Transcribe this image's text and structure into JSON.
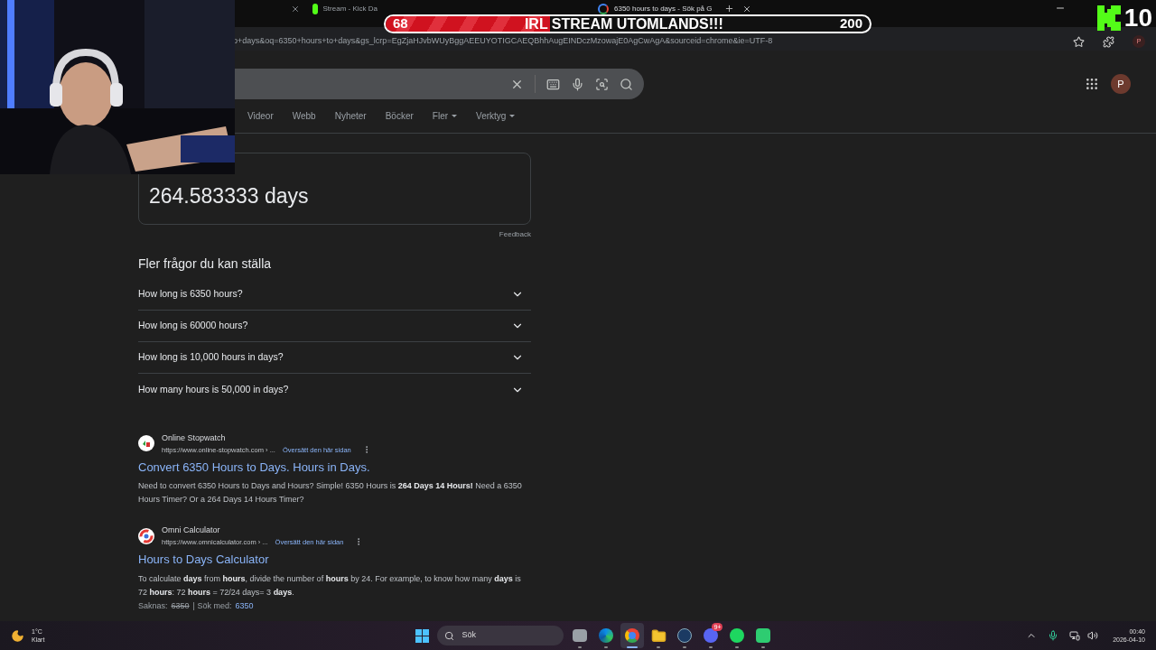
{
  "browser": {
    "tabs": [
      {
        "selected": false,
        "kind": "hidden"
      },
      {
        "title": "Stream - Kick Da",
        "selected": false,
        "kind": "kick"
      },
      {
        "title": "6350 hours to days - Sök på G",
        "selected": true,
        "kind": "google"
      }
    ],
    "url": "o+days&oq=6350+hours+to+days&gs_lcrp=EgZjaHJvbWUyBggAEEUYOTIGCAEQBhhAugEINDczMzowajE0AgCwAgA&sourceid=chrome&ie=UTF-8",
    "profile": "P"
  },
  "search": {
    "avatar": "P",
    "filters": [
      {
        "label": "Videor",
        "menu": false
      },
      {
        "label": "Webb",
        "menu": false
      },
      {
        "label": "Nyheter",
        "menu": false
      },
      {
        "label": "Böcker",
        "menu": false
      },
      {
        "label": "Fler",
        "menu": true
      },
      {
        "label": "Verktyg",
        "menu": true
      }
    ]
  },
  "calculator": {
    "result": "264.583333 days",
    "feedback": "Feedback"
  },
  "questions": {
    "heading": "Fler frågor du kan ställa",
    "items": [
      {
        "text": "How long is 6350 hours?",
        "expanded": false
      },
      {
        "text": "How long is 60000 hours?",
        "expanded": false
      },
      {
        "text": "How long is 10,000 hours in days?",
        "expanded": false
      },
      {
        "text": "How many hours is 50,000 in days?",
        "expanded": false
      }
    ]
  },
  "results": [
    {
      "kind": "stopwatch",
      "site": "Online Stopwatch",
      "url": "https://www.online-stopwatch.com › ...",
      "translate": "Översätt den här sidan",
      "title": "Convert 6350 Hours to Days. Hours in Days.",
      "snippet": "Need to convert 6350 Hours to Days and Hours? Simple! 6350 Hours is **264 Days 14 Hours!** Need a 6350 Hours Timer? Or a 264 Days 14 Hours Timer?"
    },
    {
      "kind": "omni",
      "site": "Omni Calculator",
      "url": "https://www.omnicalculator.com › ...",
      "translate": "Översätt den här sidan",
      "title": "Hours to Days Calculator",
      "snippet": "To calculate **days** from **hours**, divide the number of **hours** by 24. For example, to know how many **days** is 72 **hours**: 72 **hours** = 72/24 days= 3 **days**.",
      "missing_label": "Saknas:",
      "missing_term": "6350",
      "search_with_label": "| Sök med:",
      "search_with": "6350"
    }
  ],
  "overlay": {
    "goal": {
      "current": "68",
      "title": "IRL STREAM UTOMLANDS!!!",
      "target": "200",
      "level": 0.34
    },
    "kick_count": "10"
  },
  "taskbar": {
    "weather": {
      "temp": "1°C",
      "condition": "Klart"
    },
    "search": "Sök",
    "apps": [
      {
        "kind": "taskview",
        "active": false
      },
      {
        "kind": "edge",
        "active": false
      },
      {
        "kind": "chrome",
        "active": true
      },
      {
        "kind": "files",
        "active": false
      },
      {
        "kind": "steam",
        "active": false
      },
      {
        "kind": "discord",
        "active": false,
        "badge": "9+"
      },
      {
        "kind": "spotify",
        "active": false
      },
      {
        "kind": "app",
        "active": false
      }
    ],
    "time": "00:40",
    "date": "2026-04-10"
  }
}
